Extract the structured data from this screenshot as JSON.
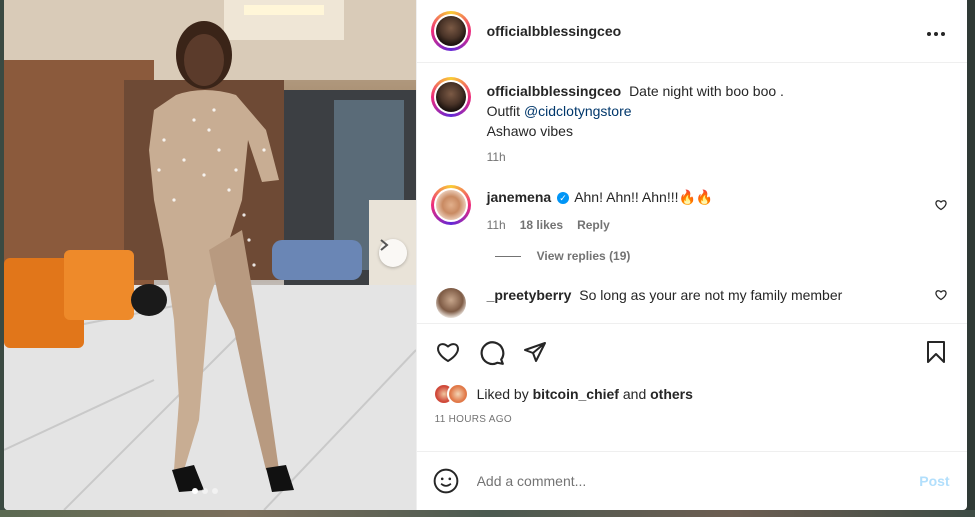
{
  "post": {
    "author": "officialbblessingceo",
    "more_icon": "more-horizontal-icon",
    "caption": {
      "user": "officialbblessingceo",
      "line1": "Date night with boo boo .",
      "line2_prefix": "Outfit",
      "mention": "@cidclotyngstore",
      "line3": "Ashawo vibes",
      "time": "11h"
    },
    "comments": [
      {
        "user": "janemena",
        "verified": true,
        "text": "Ahn! Ahn!! Ahn!!!🔥🔥",
        "time": "11h",
        "likes": "18 likes",
        "reply_label": "Reply",
        "view_replies": "View replies (19)"
      },
      {
        "user": "_preetyberry",
        "text": "So long as your are not my family member"
      }
    ],
    "liked_by_prefix": "Liked by",
    "liked_by_user": "bitcoin_chief",
    "liked_by_and": "and",
    "liked_by_others": "others",
    "timestamp": "11 HOURS AGO",
    "comment_placeholder": "Add a comment...",
    "post_label": "Post",
    "carousel": {
      "current": 1,
      "total": 3
    }
  },
  "colors": {
    "link": "#00376b",
    "post_button_disabled": "#b2dffc",
    "verified": "#0095f6",
    "muted": "#737373"
  }
}
